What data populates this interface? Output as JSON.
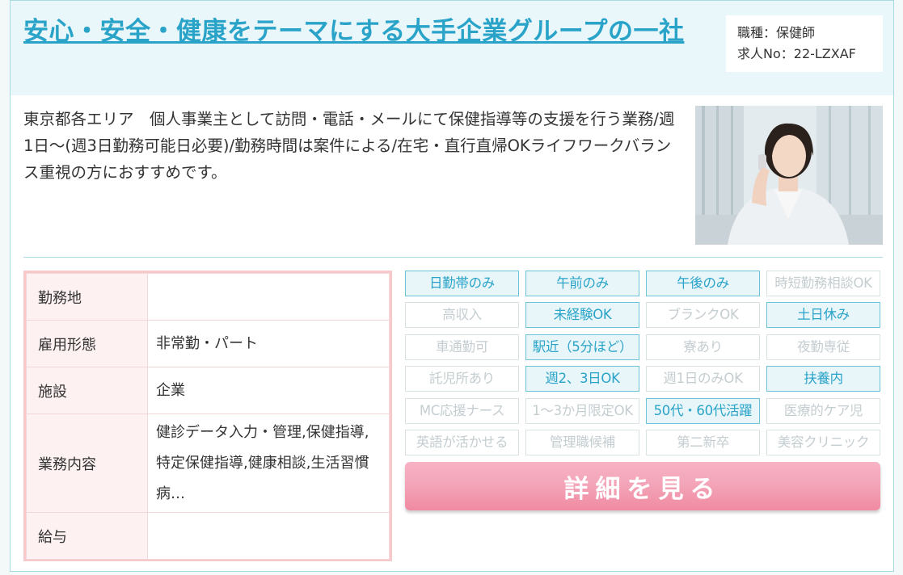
{
  "job": {
    "title": "安心・安全・健康をテーマにする大手企業グループの一社",
    "occupation": "職種：保健師",
    "job_no": "求人No：22-LZXAF",
    "description": "東京都各エリア　個人事業主として訪問・電話・メールにて保健指導等の支援を行う業務/週1日～(週3日勤務可能日必要)/勤務時間は案件による/在宅・直行直帰OKライフワークバランス重視の方におすすめです。"
  },
  "info_rows": [
    {
      "label": "勤務地",
      "value": ""
    },
    {
      "label": "雇用形態",
      "value": "非常勤・パート"
    },
    {
      "label": "施設",
      "value": "企業"
    },
    {
      "label": "業務内容",
      "value": "健診データ入力・管理,保健指導,特定保健指導,健康相談,生活習慣病…"
    },
    {
      "label": "給与",
      "value": ""
    }
  ],
  "tags": [
    {
      "label": "日勤帯のみ",
      "active": true
    },
    {
      "label": "午前のみ",
      "active": true
    },
    {
      "label": "午後のみ",
      "active": true
    },
    {
      "label": "時短勤務相談OK",
      "active": false
    },
    {
      "label": "高収入",
      "active": false
    },
    {
      "label": "未経験OK",
      "active": true
    },
    {
      "label": "ブランクOK",
      "active": false
    },
    {
      "label": "土日休み",
      "active": true
    },
    {
      "label": "車通勤可",
      "active": false
    },
    {
      "label": "駅近（5分ほど）",
      "active": true
    },
    {
      "label": "寮あり",
      "active": false
    },
    {
      "label": "夜勤専従",
      "active": false
    },
    {
      "label": "託児所あり",
      "active": false
    },
    {
      "label": "週2、3日OK",
      "active": true
    },
    {
      "label": "週1日のみOK",
      "active": false
    },
    {
      "label": "扶養内",
      "active": true
    },
    {
      "label": "MC応援ナース",
      "active": false
    },
    {
      "label": "1～3か月限定OK",
      "active": false
    },
    {
      "label": "50代・60代活躍",
      "active": true
    },
    {
      "label": "医療的ケア児",
      "active": false
    },
    {
      "label": "英語が活かせる",
      "active": false
    },
    {
      "label": "管理職候補",
      "active": false
    },
    {
      "label": "第二新卒",
      "active": false
    },
    {
      "label": "美容クリニック",
      "active": false
    }
  ],
  "detail_button": "詳細を見る",
  "colors": {
    "accent": "#29a3c8",
    "tag_active_bg": "#e8f6fa",
    "tag_inactive_text": "#c4cdd0",
    "button_pink": "#f3a3b7"
  }
}
